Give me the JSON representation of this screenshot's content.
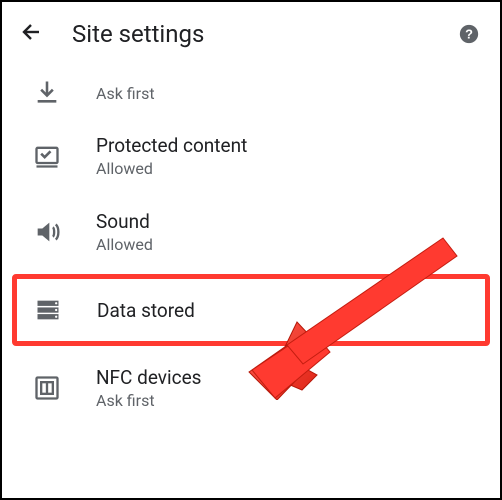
{
  "header": {
    "title": "Site settings"
  },
  "items": [
    {
      "title": "",
      "subtitle": "Ask first"
    },
    {
      "title": "Protected content",
      "subtitle": "Allowed"
    },
    {
      "title": "Sound",
      "subtitle": "Allowed"
    },
    {
      "title": "Data stored",
      "subtitle": ""
    },
    {
      "title": "NFC devices",
      "subtitle": "Ask first"
    }
  ],
  "annotation": {
    "highlight_item": "Data stored"
  }
}
